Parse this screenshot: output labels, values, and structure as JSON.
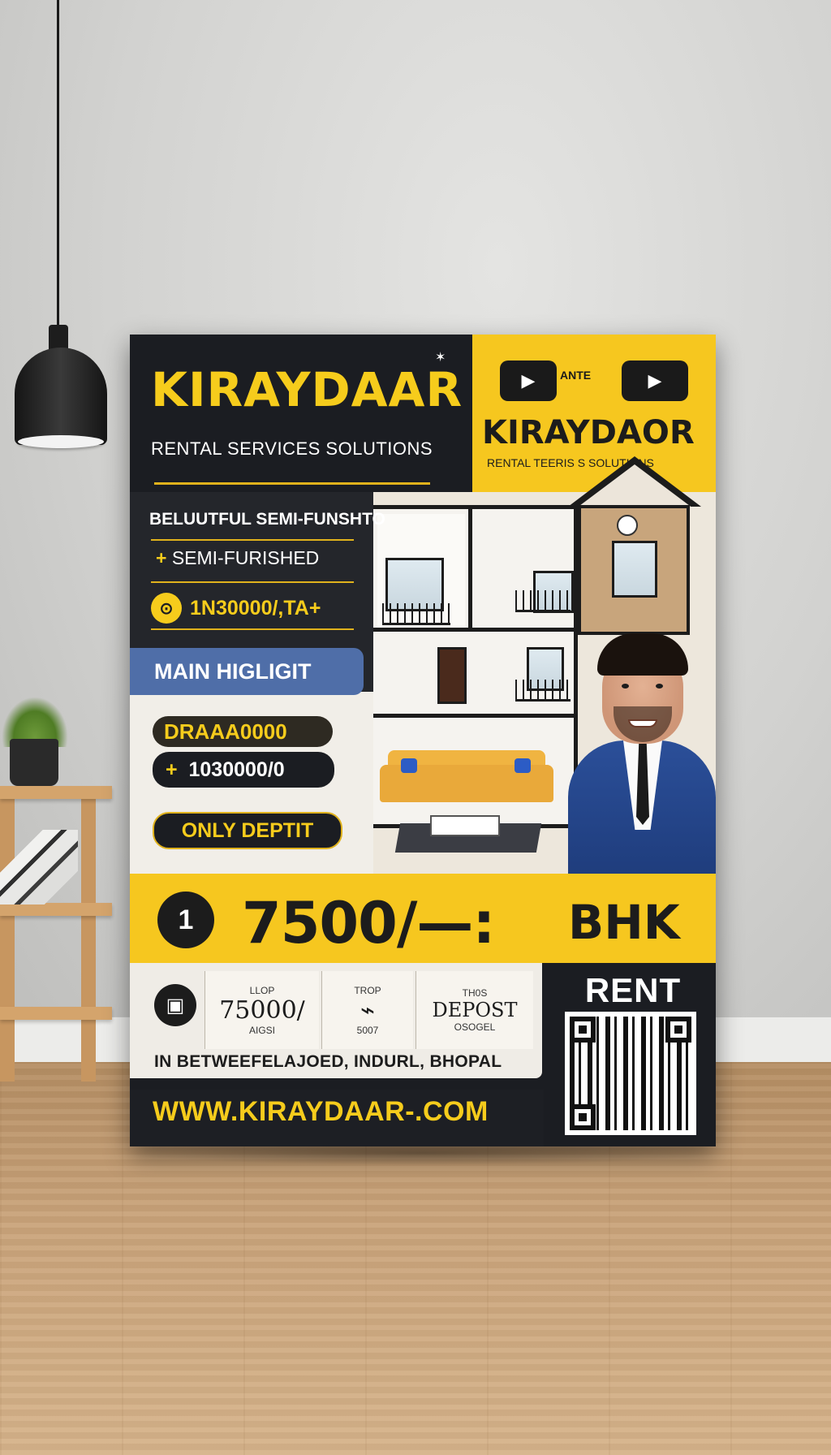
{
  "poster": {
    "brand": "KIRAYDAAR",
    "subtitle": "RENTAL SERVICES SOLUTIONS",
    "brand_alt": "KIRAYDAOR",
    "subtitle_alt": "RENTAL TEERIS S SOLUTIONS",
    "yt_middle": "ANTE",
    "description": "BELUUTFUL SEMI-FUNSHTO",
    "furnished": "SEMI-FURISHED",
    "price_line": "1N30000/,TA+",
    "highlight_title": "MAIN HIGLIGIT",
    "pill_1": "DRAAA0000",
    "pill_2": "1030000/0",
    "pill_3": "ONLY DEPTIT",
    "rent_amount": "7500/—:",
    "rent_icon": "1",
    "bhk": "BHK",
    "card_1_top": "LLOP",
    "card_1_main": "75000/",
    "card_1_bottom": "AIGSI",
    "card_2_top": "TROP",
    "card_2_bottom": "5007",
    "card_3_top": "TH0S",
    "card_3_main": "DEPOST",
    "card_3_bottom": "OSOGEL",
    "address": "IN BETWEEFELAJOED, INDURL, BHOPAL",
    "rent_label": "RENT",
    "website": "WWW.KIRAYDAAR-.COM"
  },
  "colors": {
    "accent_yellow": "#f6c71f",
    "dark_navy": "#1b1d22",
    "highlight_blue": "#4f6ea8"
  },
  "icons": [
    "play-icon",
    "play-icon",
    "coin-icon",
    "qr-code"
  ]
}
